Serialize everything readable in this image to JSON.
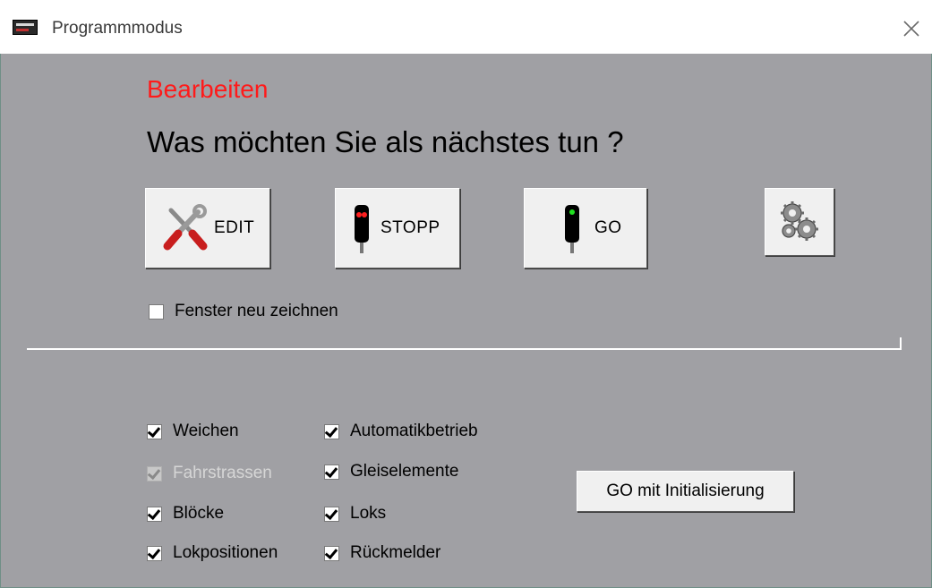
{
  "window": {
    "title": "Programmmodus"
  },
  "heading": "Bearbeiten",
  "question": "Was möchten Sie als nächstes tun ?",
  "buttons": {
    "edit": "EDIT",
    "stopp": "STOPP",
    "go": "GO",
    "gear_icon": "settings-gears-icon"
  },
  "redraw": {
    "label": "Fenster neu zeichnen",
    "checked": false
  },
  "options": {
    "col1": [
      {
        "label": "Weichen",
        "checked": true,
        "disabled": false
      },
      {
        "label": "Fahrstrassen",
        "checked": true,
        "disabled": true
      },
      {
        "label": "Blöcke",
        "checked": true,
        "disabled": false
      },
      {
        "label": "Lokpositionen",
        "checked": true,
        "disabled": false
      }
    ],
    "col2": [
      {
        "label": "Automatikbetrieb",
        "checked": true,
        "disabled": false
      },
      {
        "label": "Gleiselemente",
        "checked": true,
        "disabled": false
      },
      {
        "label": "Loks",
        "checked": true,
        "disabled": false
      },
      {
        "label": "Rückmelder",
        "checked": true,
        "disabled": false
      }
    ]
  },
  "init_button": "GO mit Initialisierung",
  "colors": {
    "heading": "#ff1a1a",
    "background": "#a0a0a4",
    "signal_red": "#ff2020",
    "signal_green": "#20e020"
  }
}
